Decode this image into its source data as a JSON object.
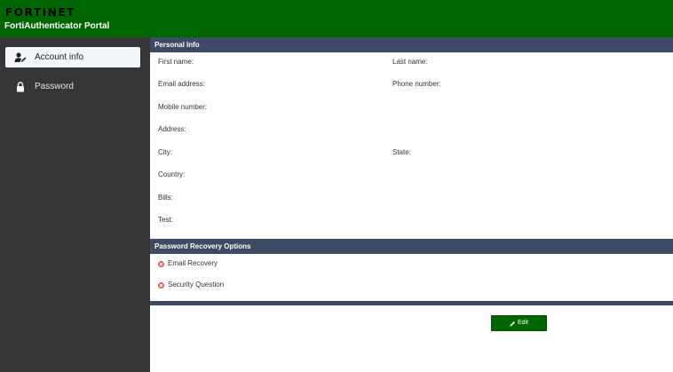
{
  "header": {
    "logo_text": "FORTINET",
    "portal_title": "FortiAuthenticator Portal"
  },
  "sidebar": {
    "items": [
      {
        "label": "Account info",
        "icon": "user-edit-icon",
        "active": true
      },
      {
        "label": "Password",
        "icon": "lock-icon",
        "active": false
      }
    ]
  },
  "personal_info": {
    "title": "Personal Info",
    "fields": {
      "first_name": {
        "label": "First name:",
        "value": ""
      },
      "last_name": {
        "label": "Last name:",
        "value": ""
      },
      "email": {
        "label": "Email address:",
        "value": ""
      },
      "phone": {
        "label": "Phone number:",
        "value": ""
      },
      "mobile": {
        "label": "Mobile number:",
        "value": ""
      },
      "address": {
        "label": "Address:",
        "value": ""
      },
      "city": {
        "label": "City:",
        "value": ""
      },
      "state": {
        "label": "State:",
        "value": ""
      },
      "country": {
        "label": "Country:",
        "value": ""
      },
      "bills": {
        "label": "Bills:",
        "value": ""
      },
      "test": {
        "label": "Test:",
        "value": ""
      }
    }
  },
  "password_recovery": {
    "title": "Password Recovery Options",
    "items": [
      {
        "label": "Email Recovery",
        "status": "disabled"
      },
      {
        "label": "Security Question",
        "status": "disabled"
      }
    ]
  },
  "actions": {
    "edit_label": "Edit"
  },
  "colors": {
    "header_green": "#006600",
    "sidebar_dark": "#353535",
    "section_bar": "#3d4a63",
    "disabled_red": "#d9534f"
  }
}
